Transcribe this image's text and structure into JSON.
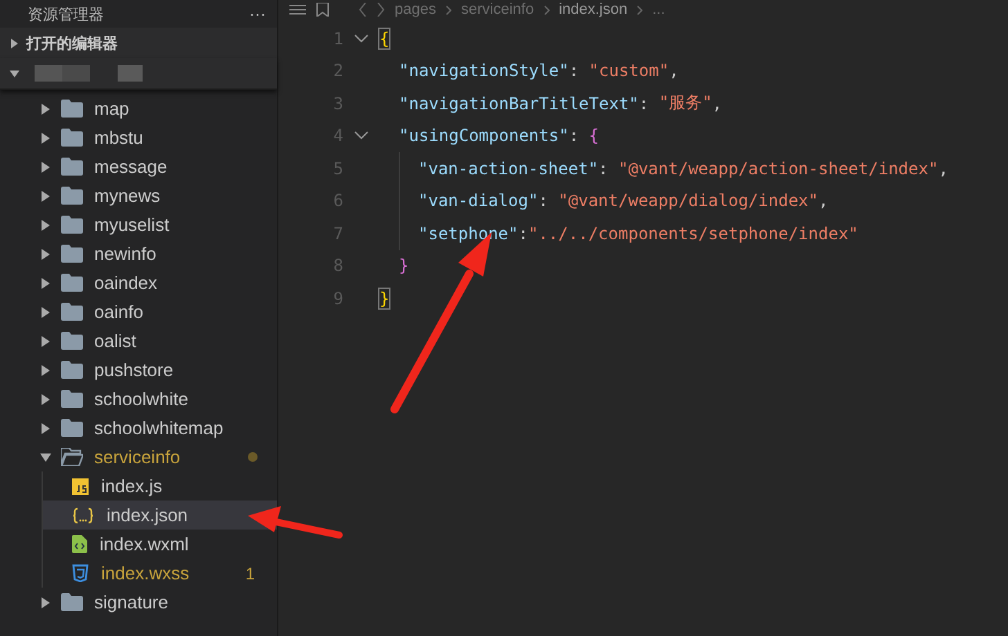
{
  "sidebar": {
    "title": "资源管理器",
    "more": "···",
    "sections": [
      {
        "label": "打开的编辑器",
        "expanded": false
      }
    ],
    "tree": [
      {
        "name": "map",
        "kind": "folder",
        "expanded": false
      },
      {
        "name": "mbstu",
        "kind": "folder",
        "expanded": false
      },
      {
        "name": "message",
        "kind": "folder",
        "expanded": false
      },
      {
        "name": "mynews",
        "kind": "folder",
        "expanded": false
      },
      {
        "name": "myuselist",
        "kind": "folder",
        "expanded": false
      },
      {
        "name": "newinfo",
        "kind": "folder",
        "expanded": false
      },
      {
        "name": "oaindex",
        "kind": "folder",
        "expanded": false
      },
      {
        "name": "oainfo",
        "kind": "folder",
        "expanded": false
      },
      {
        "name": "oalist",
        "kind": "folder",
        "expanded": false
      },
      {
        "name": "pushstore",
        "kind": "folder",
        "expanded": false
      },
      {
        "name": "schoolwhite",
        "kind": "folder",
        "expanded": false
      },
      {
        "name": "schoolwhitemap",
        "kind": "folder",
        "expanded": false
      },
      {
        "name": "serviceinfo",
        "kind": "folder",
        "expanded": true,
        "modified": true,
        "children": [
          {
            "name": "index.js",
            "kind": "js",
            "selected": false,
            "modified": false
          },
          {
            "name": "index.json",
            "kind": "json",
            "selected": true,
            "modified": false
          },
          {
            "name": "index.wxml",
            "kind": "wxml",
            "selected": false,
            "modified": false
          },
          {
            "name": "index.wxss",
            "kind": "wxss",
            "selected": false,
            "modified": true,
            "badge": "1"
          }
        ]
      },
      {
        "name": "signature",
        "kind": "folder",
        "expanded": false
      }
    ]
  },
  "breadcrumb": [
    "pages",
    "serviceinfo",
    "index.json",
    "..."
  ],
  "editor": {
    "lines": [
      {
        "number": "1",
        "fold": true,
        "tokens": [
          {
            "kind": "brace",
            "text": "{",
            "matched": true
          }
        ]
      },
      {
        "number": "2",
        "fold": false,
        "tokens": [
          {
            "kind": "key",
            "text": "  \"navigationStyle\""
          },
          {
            "kind": "punct",
            "text": ": "
          },
          {
            "kind": "string",
            "text": "\"custom\""
          },
          {
            "kind": "punct",
            "text": ","
          }
        ]
      },
      {
        "number": "3",
        "fold": false,
        "tokens": [
          {
            "kind": "key",
            "text": "  \"navigationBarTitleText\""
          },
          {
            "kind": "punct",
            "text": ": "
          },
          {
            "kind": "string",
            "text": "\"服务\""
          },
          {
            "kind": "punct",
            "text": ","
          }
        ]
      },
      {
        "number": "4",
        "fold": true,
        "tokens": [
          {
            "kind": "key",
            "text": "  \"usingComponents\""
          },
          {
            "kind": "punct",
            "text": ": "
          },
          {
            "kind": "brace2",
            "text": "{"
          }
        ]
      },
      {
        "number": "5",
        "fold": false,
        "tokens": [
          {
            "kind": "key",
            "text": "    \"van-action-sheet\""
          },
          {
            "kind": "punct",
            "text": ": "
          },
          {
            "kind": "string",
            "text": "\"@vant/weapp/action-sheet/index\""
          },
          {
            "kind": "punct",
            "text": ","
          }
        ]
      },
      {
        "number": "6",
        "fold": false,
        "tokens": [
          {
            "kind": "key",
            "text": "    \"van-dialog\""
          },
          {
            "kind": "punct",
            "text": ": "
          },
          {
            "kind": "string",
            "text": "\"@vant/weapp/dialog/index\""
          },
          {
            "kind": "punct",
            "text": ","
          }
        ]
      },
      {
        "number": "7",
        "fold": false,
        "tokens": [
          {
            "kind": "key",
            "text": "    \"setphone\""
          },
          {
            "kind": "punct",
            "text": ":"
          },
          {
            "kind": "string",
            "text": "\"../../components/setphone/index\""
          }
        ]
      },
      {
        "number": "8",
        "fold": false,
        "tokens": [
          {
            "kind": "brace2",
            "text": "  }"
          }
        ]
      },
      {
        "number": "9",
        "fold": false,
        "tokens": [
          {
            "kind": "brace",
            "text": "}",
            "matched": true
          }
        ]
      }
    ]
  }
}
